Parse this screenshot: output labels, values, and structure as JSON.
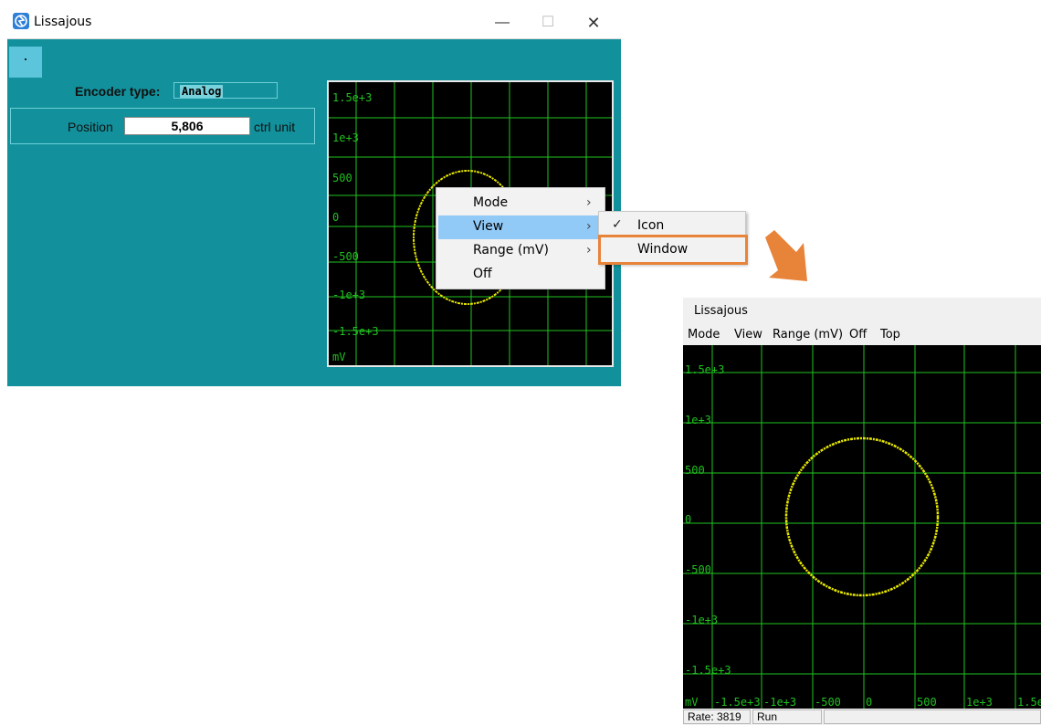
{
  "small_window": {
    "title": "Lissajous",
    "titlebar_buttons": {
      "minimize": "—",
      "maximize": "☐",
      "close": "✕"
    },
    "dot_button": "·",
    "encoder_label": "Encoder type:",
    "encoder_value": "Analog",
    "position_label": "Position",
    "position_value": "5,806",
    "position_unit": "ctrl unit",
    "scope_y_labels": [
      "1.5e+3",
      "1e+3",
      "500",
      "0",
      "-500",
      "-1e+3",
      "-1.5e+3",
      "mV"
    ]
  },
  "context_menu": {
    "items": [
      {
        "label": "Mode",
        "has_submenu": true
      },
      {
        "label": "View",
        "has_submenu": true,
        "highlighted": true
      },
      {
        "label": "Range (mV)",
        "has_submenu": true
      },
      {
        "label": "Off",
        "has_submenu": false
      }
    ],
    "submenu": [
      {
        "label": "Icon",
        "checked": true
      },
      {
        "label": "Window",
        "checked": false,
        "callout": true
      }
    ]
  },
  "large_window": {
    "title": "Lissajous",
    "menubar": [
      "Mode",
      "View",
      "Range (mV)",
      "Off",
      "Top"
    ],
    "scope_y_labels": [
      "1.5e+3",
      "1e+3",
      "500",
      "0",
      "-500",
      "-1e+3",
      "-1.5e+3"
    ],
    "scope_x_labels": [
      "mV",
      "-1.5e+3",
      "-1e+3",
      "-500",
      "0",
      "500",
      "1e+3",
      "1.5e"
    ],
    "status": {
      "rate": "Rate: 3819",
      "state": "Run"
    }
  },
  "colors": {
    "window_bg": "#12909b",
    "scope_bg": "#000000",
    "grid": "#1fc41f",
    "trace": "#e6e600",
    "menu_highlight": "#91c9f7",
    "callout": "#e8833a"
  }
}
